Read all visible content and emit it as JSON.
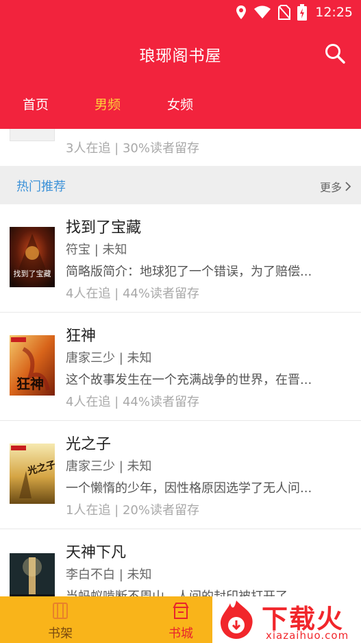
{
  "status_bar": {
    "time": "12:25",
    "icons": [
      "location-icon",
      "wifi-icon",
      "no-sim-icon",
      "battery-charging-icon"
    ]
  },
  "header": {
    "title": "琅琊阁书屋",
    "search_icon": "search-icon",
    "tabs": [
      {
        "label": "首页",
        "active": false
      },
      {
        "label": "男频",
        "active": true
      },
      {
        "label": "女频",
        "active": false
      }
    ],
    "active_tab_color": "#ffd23a",
    "bg_color": "#f2233d"
  },
  "previous_item": {
    "meta": "3人在追 | 30%读者留存"
  },
  "section": {
    "title": "热门推荐",
    "more_label": "更多",
    "title_color": "#3d92d8"
  },
  "books": [
    {
      "title": "找到了宝藏",
      "author_line": "符宝 | 未知",
      "desc": "简略版简介：地球犯了一个错误，为了赔偿...",
      "meta": "4人在追 | 44%读者留存",
      "cover_text": "找到了宝藏"
    },
    {
      "title": "狂神",
      "author_line": "唐家三少 | 未知",
      "desc": "这个故事发生在一个充满战争的世界，在晋...",
      "meta": "4人在追 | 44%读者留存",
      "cover_text": "狂神"
    },
    {
      "title": "光之子",
      "author_line": "唐家三少 | 未知",
      "desc": "一个懒惰的少年，因性格原因选学了无人问...",
      "meta": "1人在追 | 20%读者留存",
      "cover_text": "光之子"
    },
    {
      "title": "天神下凡",
      "author_line": "李白不白 | 未知",
      "desc": "当蚂蚁啃断不周山，人间的封印被打开了...",
      "meta": "",
      "cover_text": ""
    }
  ],
  "bottom_nav": [
    {
      "label": "书架",
      "icon": "bookshelf-icon",
      "active": false
    },
    {
      "label": "书城",
      "icon": "store-icon",
      "active": true
    }
  ],
  "bottom_nav_colors": {
    "bg": "#f9b41a",
    "active": "#e8242c",
    "inactive": "#7a4a10"
  },
  "watermark": {
    "text": "下载火",
    "sub": "xiazaihuo.com"
  }
}
